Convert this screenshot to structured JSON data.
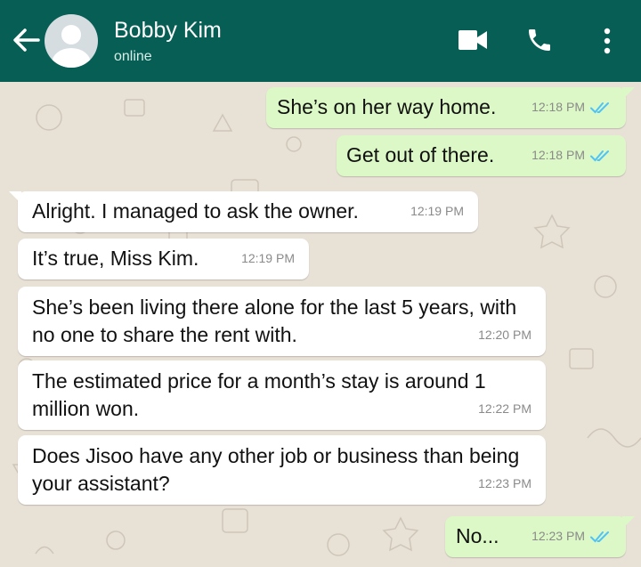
{
  "header": {
    "contact_name": "Bobby Kim",
    "status": "online",
    "icons": [
      "back-arrow-icon",
      "avatar-placeholder-icon",
      "video-call-icon",
      "phone-call-icon",
      "more-options-icon"
    ],
    "background_color": "#075e54"
  },
  "colors": {
    "outgoing_bubble": "#dcf8c6",
    "incoming_bubble": "#ffffff",
    "read_ticks": "#4fc3f7",
    "chat_background": "#e8e1d6"
  },
  "messages": [
    {
      "direction": "out",
      "text": "She’s on her way home.",
      "time": "12:18 PM",
      "read": true
    },
    {
      "direction": "out",
      "text": "Get out of there.",
      "time": "12:18 PM",
      "read": true
    },
    {
      "direction": "in",
      "text": "Alright. I managed to ask the owner.",
      "time": "12:19 PM"
    },
    {
      "direction": "in",
      "text": "It’s true, Miss Kim.",
      "time": "12:19 PM"
    },
    {
      "direction": "in",
      "text": "She’s been living there alone for the last 5 years, with\nno one to share the rent with.",
      "time": "12:20 PM"
    },
    {
      "direction": "in",
      "text": "The estimated price for a month’s stay is around 1\nmillion won.",
      "time": "12:22 PM"
    },
    {
      "direction": "in",
      "text": "Does Jisoo have any other job or business than being\nyour assistant?",
      "time": "12:23 PM"
    },
    {
      "direction": "out",
      "text": "No...",
      "time": "12:23 PM",
      "read": true
    }
  ]
}
